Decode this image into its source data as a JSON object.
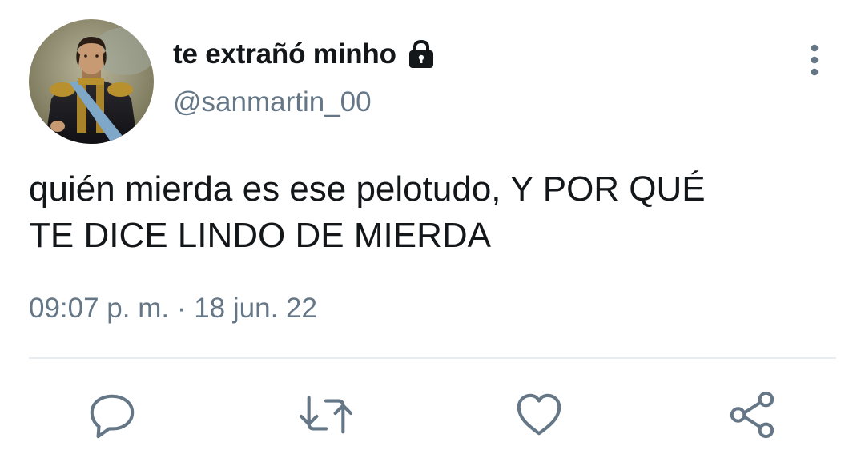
{
  "tweet": {
    "display_name": "te extrañó minho",
    "handle": "@sanmartin_00",
    "protected_icon": "lock-icon",
    "text_lines": [
      "quién mierda es ese pelotudo, Y POR QUÉ",
      "TE DICE LINDO DE MIERDA"
    ],
    "timestamp": "09:07 p. m. · 18 jun. 22"
  },
  "icons": {
    "more": "more-vertical-icon",
    "reply": "reply-icon",
    "retweet": "retweet-icon",
    "like": "heart-icon",
    "share": "share-icon"
  },
  "colors": {
    "text": "#14171a",
    "secondary": "#657786",
    "divider": "#e6ecf0"
  }
}
